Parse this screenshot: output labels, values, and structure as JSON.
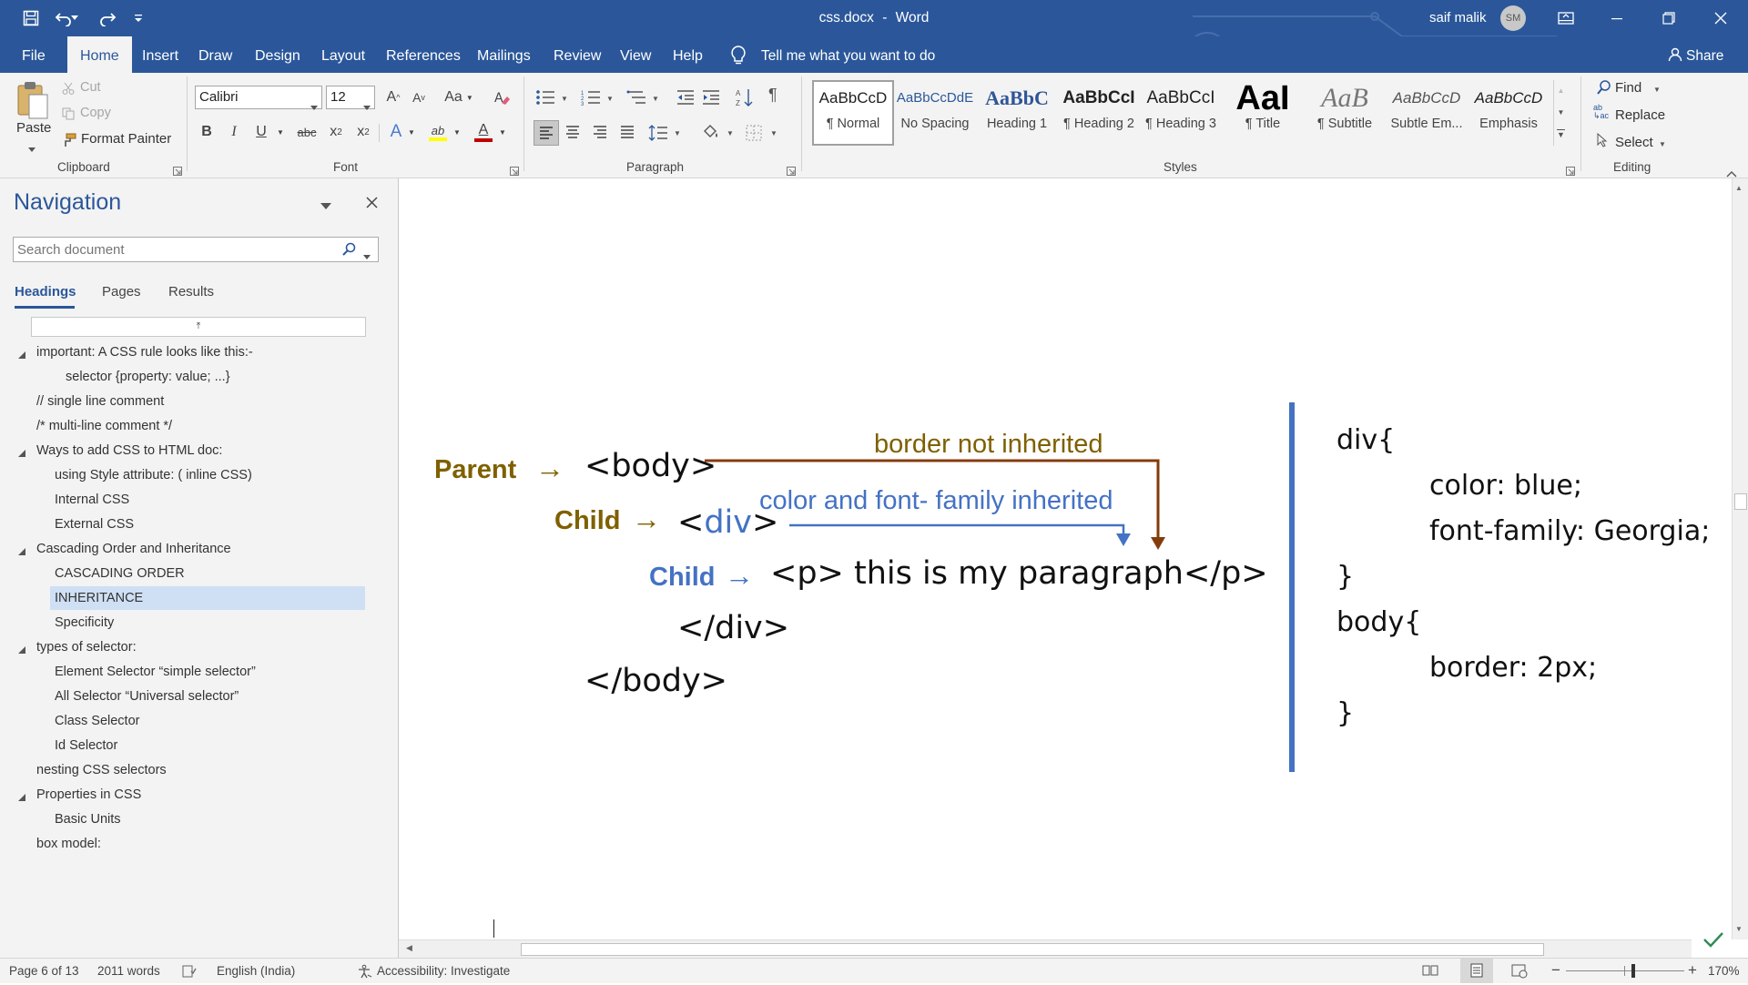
{
  "titlebar": {
    "doc_title": "css.docx",
    "separator": "-",
    "app_name": "Word",
    "user_name": "saif malik",
    "user_initials": "SM"
  },
  "tabs": [
    {
      "label": "File"
    },
    {
      "label": "Home"
    },
    {
      "label": "Insert"
    },
    {
      "label": "Draw"
    },
    {
      "label": "Design"
    },
    {
      "label": "Layout"
    },
    {
      "label": "References"
    },
    {
      "label": "Mailings"
    },
    {
      "label": "Review"
    },
    {
      "label": "View"
    },
    {
      "label": "Help"
    }
  ],
  "tell_me": "Tell me what you want to do",
  "share_label": "Share",
  "clipboard": {
    "paste": "Paste",
    "cut": "Cut",
    "copy": "Copy",
    "format_painter": "Format Painter",
    "group": "Clipboard"
  },
  "font": {
    "name": "Calibri",
    "size": "12",
    "grow": "A",
    "shrink": "A",
    "change_case": "Aa",
    "bold": "B",
    "italic": "I",
    "underline": "U",
    "strike": "abc",
    "subscript_base": "x",
    "subscript_mark": "2",
    "superscript_base": "x",
    "superscript_mark": "2",
    "text_effects": "A",
    "highlight": "ab",
    "font_color": "A",
    "group": "Font"
  },
  "paragraph": {
    "group": "Paragraph"
  },
  "styles": {
    "items": [
      {
        "preview": "AaBbCcD",
        "name": "¶ Normal"
      },
      {
        "preview": "AaBbCcDdE",
        "name": "No Spacing"
      },
      {
        "preview": "AaBbC",
        "name": "Heading 1"
      },
      {
        "preview": "AaBbCcI",
        "name": "¶ Heading 2"
      },
      {
        "preview": "AaBbCcI",
        "name": "¶ Heading 3"
      },
      {
        "preview": "AaI",
        "name": "¶ Title"
      },
      {
        "preview": "AaB",
        "name": "¶ Subtitle"
      },
      {
        "preview": "AaBbCcD",
        "name": "Subtle Em..."
      },
      {
        "preview": "AaBbCcD",
        "name": "Emphasis"
      }
    ],
    "group": "Styles"
  },
  "editing": {
    "find": "Find",
    "replace": "Replace",
    "select": "Select",
    "group": "Editing"
  },
  "navigation": {
    "title": "Navigation",
    "search_placeholder": "Search document",
    "tabs": [
      "Headings",
      "Pages",
      "Results"
    ],
    "headings": [
      {
        "text": "important: A CSS rule looks like this:-",
        "level": 1,
        "expander": true
      },
      {
        "text": "selector {property: value; ...}",
        "level": 3,
        "expander": false
      },
      {
        "text": "// single line comment",
        "level": 1,
        "expander": false
      },
      {
        "text": "/* multi-line comment */",
        "level": 1,
        "expander": false
      },
      {
        "text": "Ways to add CSS to HTML doc:",
        "level": 1,
        "expander": true
      },
      {
        "text": "using Style attribute: ( inline CSS)",
        "level": 2,
        "expander": false
      },
      {
        "text": "Internal CSS",
        "level": 2,
        "expander": false
      },
      {
        "text": "External CSS",
        "level": 2,
        "expander": false
      },
      {
        "text": "Cascading Order and Inheritance",
        "level": 1,
        "expander": true
      },
      {
        "text": "CASCADING ORDER",
        "level": 2,
        "expander": false
      },
      {
        "text": "INHERITANCE",
        "level": 2,
        "expander": false,
        "selected": true
      },
      {
        "text": "Specificity",
        "level": 2,
        "expander": false
      },
      {
        "text": "types of selector:",
        "level": 1,
        "expander": true
      },
      {
        "text": "Element Selector  “simple selector”",
        "level": 2,
        "expander": false
      },
      {
        "text": "All Selector   “Universal selector”",
        "level": 2,
        "expander": false
      },
      {
        "text": "Class Selector",
        "level": 2,
        "expander": false
      },
      {
        "text": "Id Selector",
        "level": 2,
        "expander": false
      },
      {
        "text": "nesting CSS selectors",
        "level": 1,
        "expander": false
      },
      {
        "text": "Properties in CSS",
        "level": 1,
        "expander": true
      },
      {
        "text": "Basic Units",
        "level": 2,
        "expander": false
      },
      {
        "text": "box model:",
        "level": 1,
        "expander": false
      }
    ]
  },
  "diagram": {
    "parent_label": "Parent",
    "child1_label": "Child",
    "child2_label": "Child",
    "arrow": "→",
    "body_open": "<body>",
    "div_open_lt": "<",
    "div_open_name": "div",
    "div_open_gt": ">",
    "p_line": "<p> this is my paragraph</p>",
    "div_close": "</div>",
    "body_close": "</body>",
    "border_note": "border not inherited",
    "color_note": "color and font- family inherited"
  },
  "css_code": {
    "lines": [
      {
        "text": "div{",
        "indent": false
      },
      {
        "text": "color: blue;",
        "indent": true
      },
      {
        "text": "font-family: Georgia;",
        "indent": true
      },
      {
        "text": "}",
        "indent": false
      },
      {
        "text": "body{",
        "indent": false
      },
      {
        "text": "border: 2px;",
        "indent": true
      },
      {
        "text": "}",
        "indent": false
      }
    ]
  },
  "status": {
    "page": "Page 6 of 13",
    "words": "2011 words",
    "language": "English (India)",
    "accessibility": "Accessibility: Investigate",
    "zoom_minus": "−",
    "zoom_plus": "+",
    "zoom": "170%"
  },
  "colors": {
    "word_blue": "#2b579a",
    "parent_brown": "#7f6000",
    "child_blue": "#4472c4",
    "inherit_arrow_red": "#843c0c",
    "selected_heading": "#cfe0f5"
  }
}
